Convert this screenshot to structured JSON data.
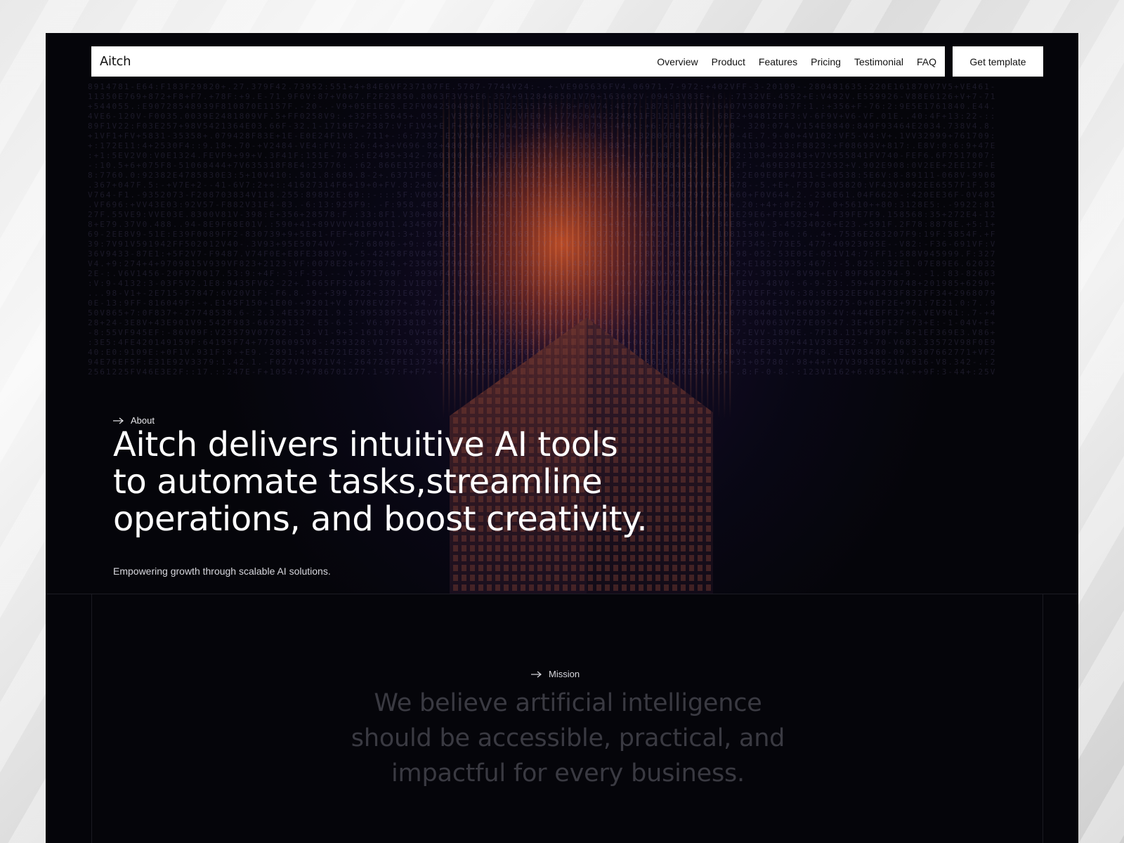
{
  "nav": {
    "logo": "Aitch",
    "links": [
      "Overview",
      "Product",
      "Features",
      "Pricing",
      "Testimonial",
      "FAQ"
    ],
    "cta_label": "Get template"
  },
  "hero": {
    "tag": "About",
    "tag_icon": "arrow-right-icon",
    "headline_lines": [
      "Aitch delivers intuitive AI tools",
      "to automate tasks,streamline",
      "operations, and boost creativity."
    ],
    "subtitle": "Empowering growth through scalable AI solutions."
  },
  "mission": {
    "tag": "Mission",
    "tag_icon": "arrow-right-icon",
    "text_lines": [
      "We believe artificial intelligence",
      "should be accessible, practical, and",
      "impactful for every business."
    ]
  },
  "colors": {
    "hero_glow": "#c9552a",
    "page_bg": "#05050a",
    "nav_bg": "#ffffff",
    "mission_text": "#3a3a42"
  }
}
